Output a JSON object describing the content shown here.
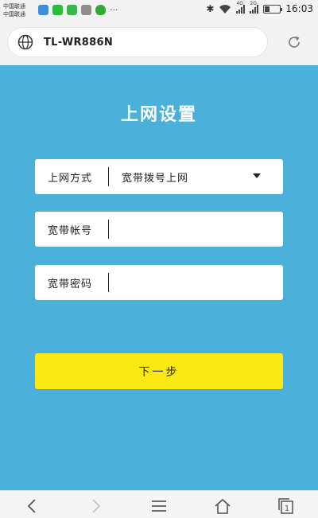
{
  "status_bar": {
    "carrier_1": "中国联通",
    "carrier_2": "中国联通",
    "signal_1_label": "4G",
    "signal_2_label": "2G",
    "time": "16:03",
    "bluetooth_glyph": "✱",
    "more_glyph": "···"
  },
  "browser": {
    "address": "TL-WR886N"
  },
  "page": {
    "title": "上网设置",
    "fields": {
      "connection_type": {
        "label": "上网方式",
        "value": "宽带拨号上网"
      },
      "account": {
        "label": "宽带帐号",
        "value": ""
      },
      "password": {
        "label": "宽带密码",
        "value": ""
      }
    },
    "next_button": "下一步"
  },
  "colors": {
    "background": "#4bb0da",
    "button": "#fbe913"
  },
  "nav_icons": [
    "back-icon",
    "forward-icon",
    "menu-icon",
    "home-icon",
    "tabs-icon"
  ],
  "tabs_count": "1"
}
